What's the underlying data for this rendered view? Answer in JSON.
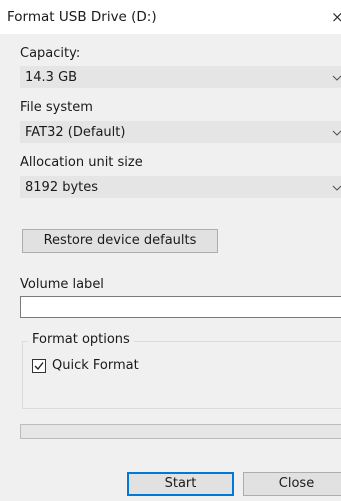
{
  "window": {
    "title": "Format USB Drive (D:)",
    "close_glyph": "×"
  },
  "capacity": {
    "label": "Capacity:",
    "value": "14.3 GB"
  },
  "file_system": {
    "label": "File system",
    "value": "FAT32 (Default)"
  },
  "allocation": {
    "label": "Allocation unit size",
    "value": "8192 bytes"
  },
  "restore_button": "Restore device defaults",
  "volume": {
    "label": "Volume label",
    "value": ""
  },
  "format_options": {
    "title": "Format options",
    "quick_format": {
      "label": "Quick Format",
      "checked": true
    }
  },
  "progress": {
    "fraction": 0
  },
  "buttons": {
    "start": "Start",
    "close": "Close"
  },
  "icons": {
    "dropdown": "chevron-down-icon",
    "checkmark": "checkmark-icon",
    "close": "close-icon"
  }
}
